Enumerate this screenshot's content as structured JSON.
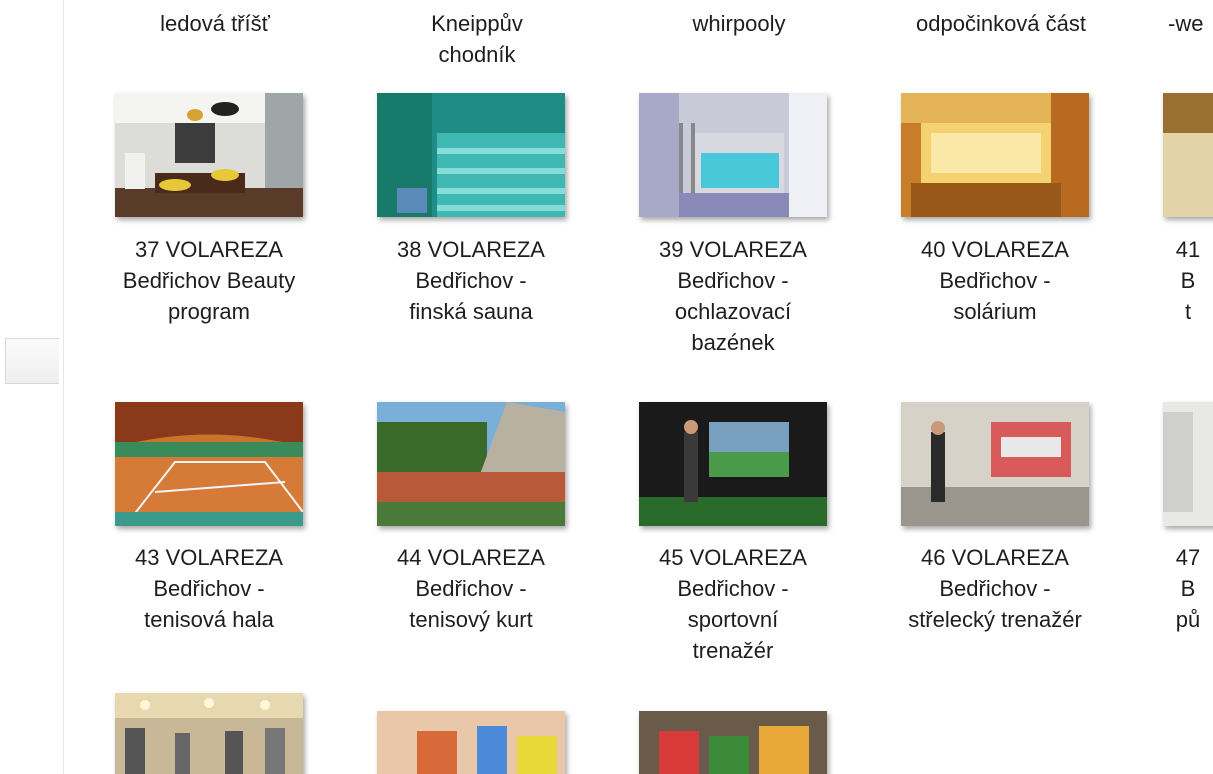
{
  "top_row": [
    {
      "label": "ledová tříšť"
    },
    {
      "label": "Kneippův\nchodník"
    },
    {
      "label": "whirpooly"
    },
    {
      "label": "odpočinková část"
    },
    {
      "label": "-we"
    }
  ],
  "row1": [
    {
      "label": "37 VOLAREZA\nBedřichov Beauty\nprogram",
      "icon": "beauty-salon-thumbnail"
    },
    {
      "label": "38 VOLAREZA\nBedřichov -\nfinská sauna",
      "icon": "finnish-sauna-thumbnail"
    },
    {
      "label": "39 VOLAREZA\nBedřichov -\nochlazovací\nbazének",
      "icon": "cooling-pool-thumbnail"
    },
    {
      "label": "40 VOLAREZA\nBedřichov -\nsolárium",
      "icon": "solarium-thumbnail"
    },
    {
      "label": "41\nB\nt",
      "icon": "gym-hall-thumbnail"
    }
  ],
  "row2": [
    {
      "label": "43 VOLAREZA\nBedřichov -\ntenisová hala",
      "icon": "tennis-hall-thumbnail"
    },
    {
      "label": "44 VOLAREZA\nBedřichov -\ntenisový kurt",
      "icon": "tennis-court-thumbnail"
    },
    {
      "label": "45 VOLAREZA\nBedřichov -\nsportovní\ntrenažér",
      "icon": "sport-simulator-thumbnail"
    },
    {
      "label": "46 VOLAREZA\nBedřichov -\nstřelecký trenažér",
      "icon": "shooting-simulator-thumbnail"
    },
    {
      "label": "47\nB\npů",
      "icon": "partial-thumbnail"
    }
  ],
  "row3": [
    {
      "icon": "fitness-room-thumbnail"
    },
    {
      "icon": "kids-playroom-thumbnail"
    },
    {
      "icon": "kids-play-area-thumbnail"
    }
  ],
  "colors": {
    "nav_border": "#e3e8ee",
    "text": "#1e1e1e"
  }
}
